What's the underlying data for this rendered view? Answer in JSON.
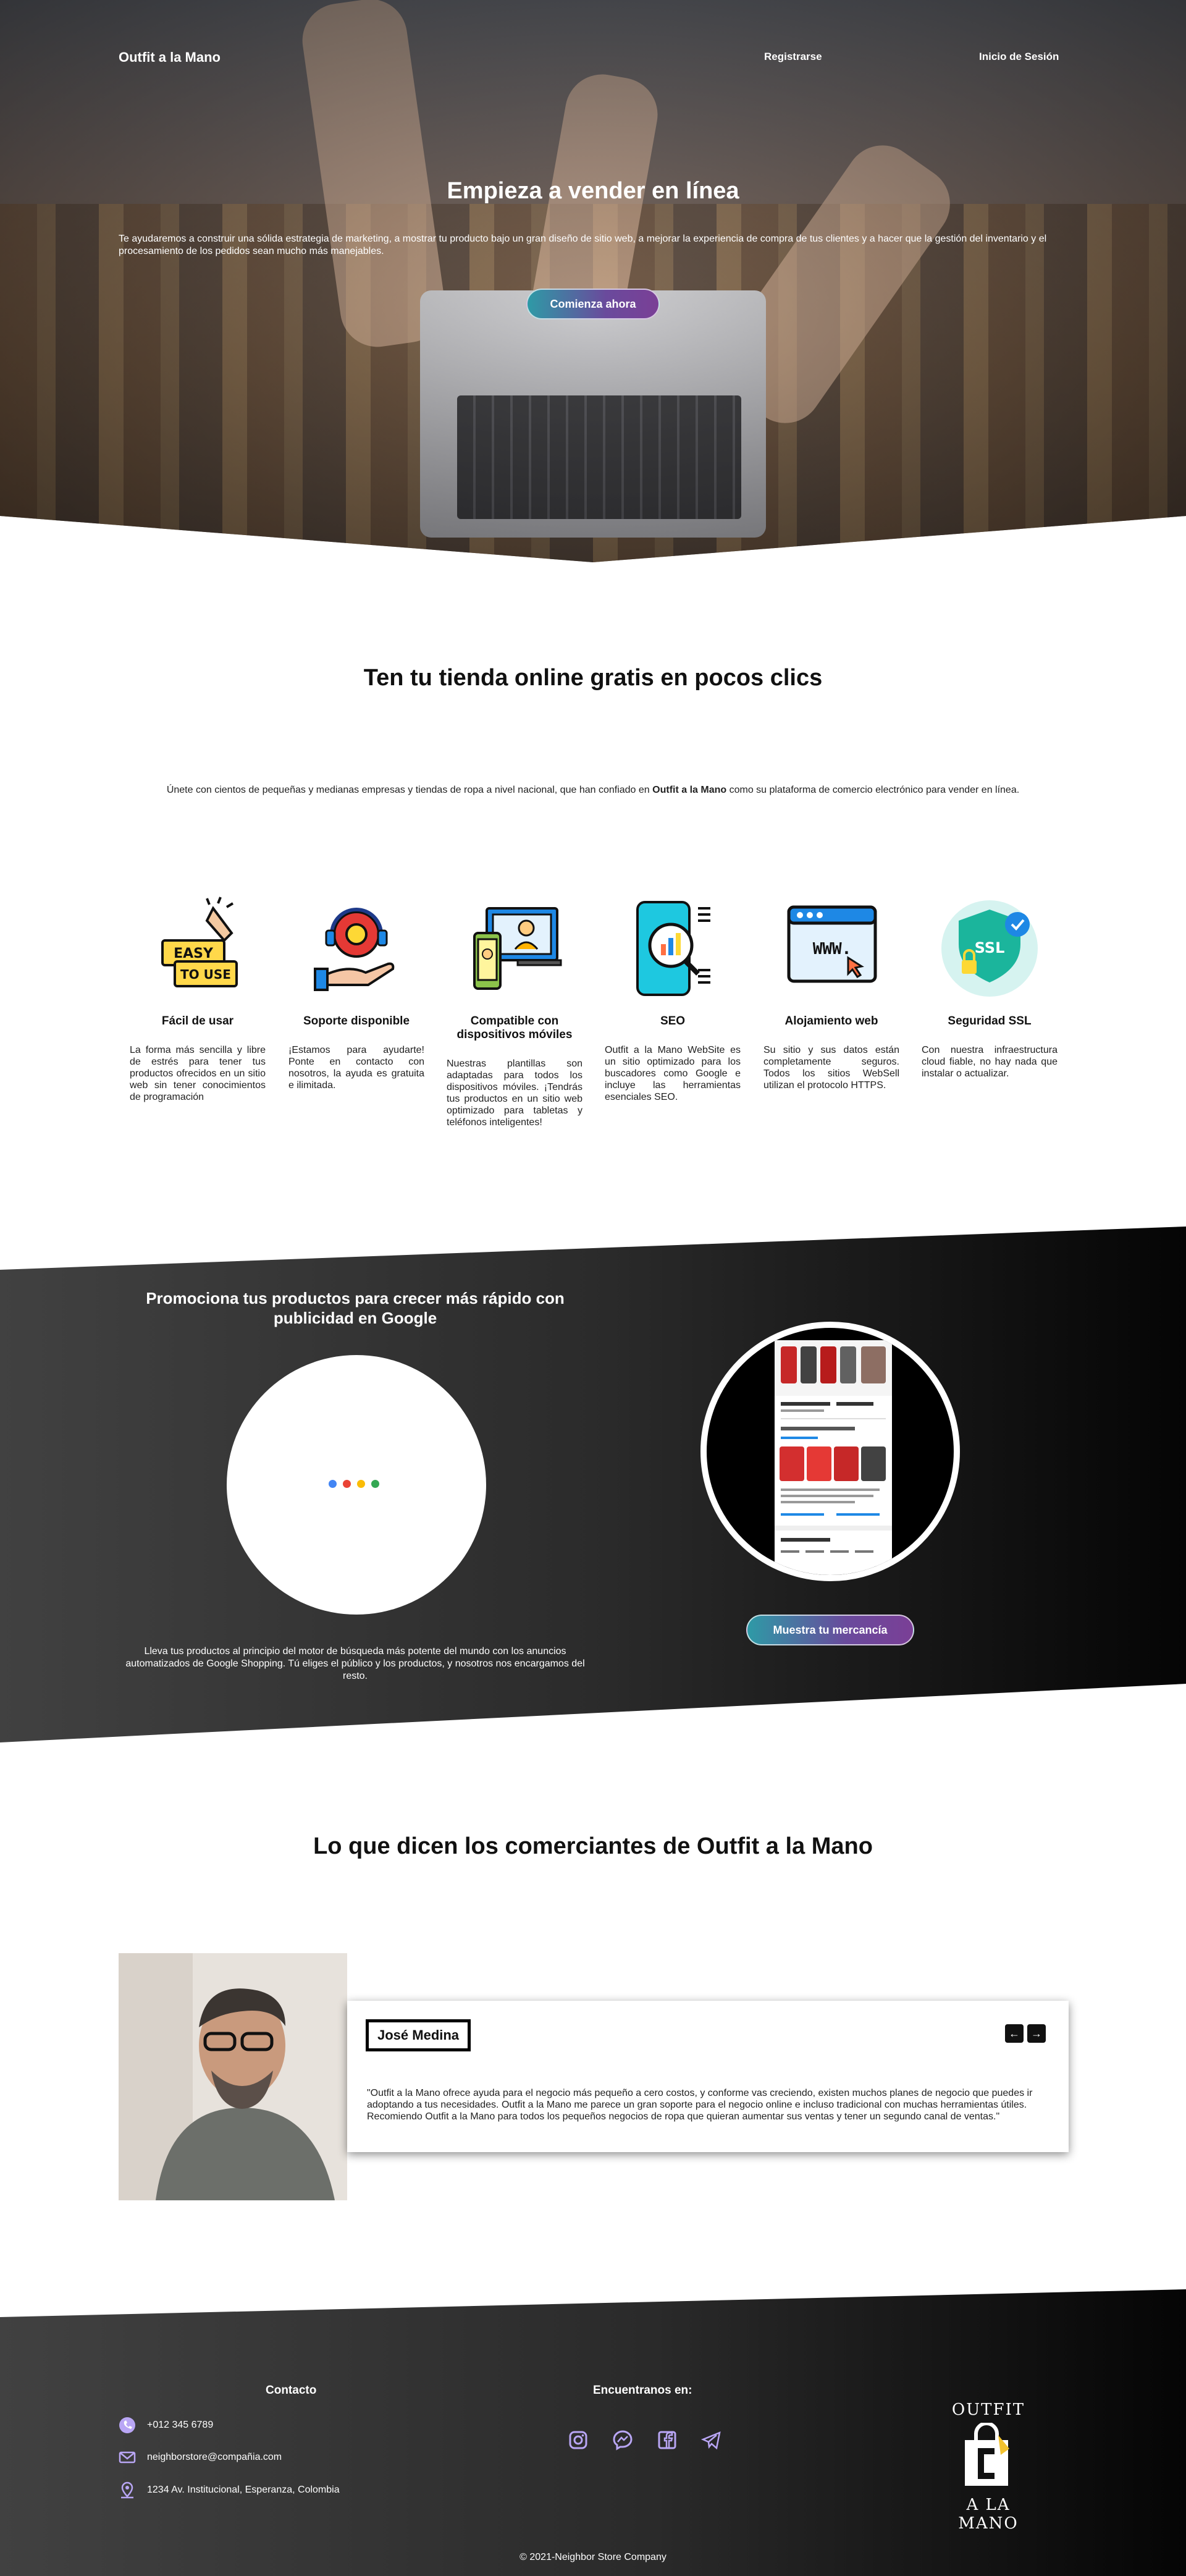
{
  "hero": {
    "brand": "Outfit a la Mano",
    "nav": {
      "register": "Registrarse",
      "login": "Inicio de Sesión"
    },
    "title": "Empieza a vender en línea",
    "text": "Te ayudaremos a construir una sólida estrategia de marketing, a mostrar tu producto bajo un gran diseño de sitio web, a mejorar la experiencia de compra de tus clientes y a hacer que la gestión del inventario y el procesamiento de los pedidos sean mucho más manejables.",
    "cta": "Comienza ahora"
  },
  "intro": {
    "title": "Ten tu tienda online gratis en pocos clics",
    "text_before": "Únete con cientos de pequeñas y medianas empresas y tiendas de ropa a nivel nacional, que han confiado en ",
    "text_brand": "Outfit a la Mano",
    "text_after": " como su plataforma de comercio electrónico para vender en línea."
  },
  "features": [
    {
      "icon": "easy-to-use-icon",
      "title": "Fácil de usar",
      "text": "La forma más sencilla y libre de estrés para tener tus productos ofrecidos en un sitio web sin tener conocimientos de programación",
      "badge_line1": "EASY",
      "badge_line2": "TO USE"
    },
    {
      "icon": "support-icon",
      "title": "Soporte disponible",
      "text": "¡Estamos para ayudarte! Ponte en contacto con nosotros, la ayuda es gratuita e ilimitada."
    },
    {
      "icon": "mobile-devices-icon",
      "title": "Compatible con dispositivos móviles",
      "text": "Nuestras plantillas son adaptadas para todos los dispositivos móviles. ¡Tendrás tus productos en un sitio web optimizado para tabletas y teléfonos inteligentes!"
    },
    {
      "icon": "seo-icon",
      "title": "SEO",
      "text": "Outfit a la Mano WebSite es un sitio optimizado para los buscadores como Google e incluye las herramientas esenciales SEO."
    },
    {
      "icon": "web-hosting-icon",
      "title": "Alojamiento web",
      "text": "Su sitio y sus datos están completamente seguros. Todos los sitios WebSell utilizan el protocolo HTTPS.",
      "badge": "WWW."
    },
    {
      "icon": "ssl-shield-icon",
      "title": "Seguridad SSL",
      "text": "Con nuestra infraestructura cloud fiable, no hay nada que instalar o actualizar.",
      "badge": "SSL"
    }
  ],
  "promo": {
    "title": "Promociona tus productos para crecer más rápido con publicidad en Google",
    "text": "Lleva tus productos al principio del motor de búsqueda más potente del mundo con los anuncios automatizados de Google Shopping. Tú eliges el público y los productos, y nosotros nos encargamos del resto.",
    "cta": "Muestra tu mercancía",
    "google_colors": [
      "#4285f4",
      "#ea4335",
      "#fbbc05",
      "#34a853"
    ]
  },
  "testimonials": {
    "title": "Lo que dicen los comerciantes de Outfit a la Mano",
    "name": "José Medina",
    "quote": "\"Outfit a la Mano ofrece ayuda para el negocio más pequeño a cero costos, y conforme vas creciendo, existen muchos planes de negocio que puedes ir adoptando a tus necesidades. Outfit a la Mano me parece un gran soporte para el negocio online e incluso tradicional con muchas herramientas útiles. Recomiendo Outfit a la Mano para todos los pequeños negocios de ropa que quieran aumentar sus ventas y tener un segundo canal de ventas.\"",
    "prev": "←",
    "next": "→"
  },
  "footer": {
    "contact_title": "Contacto",
    "phone": "+012 345 6789",
    "email": "neighborstore@compañia.com",
    "address": "1234 Av. Institucional, Esperanza, Colombia",
    "social_title": "Encuentranos en:",
    "social": [
      "instagram-icon",
      "messenger-icon",
      "facebook-icon",
      "telegram-icon"
    ],
    "brand_top": "OUTFIT",
    "brand_bottom": "A LA MANO",
    "copyright": "© 2021-Neighbor Store Company"
  }
}
